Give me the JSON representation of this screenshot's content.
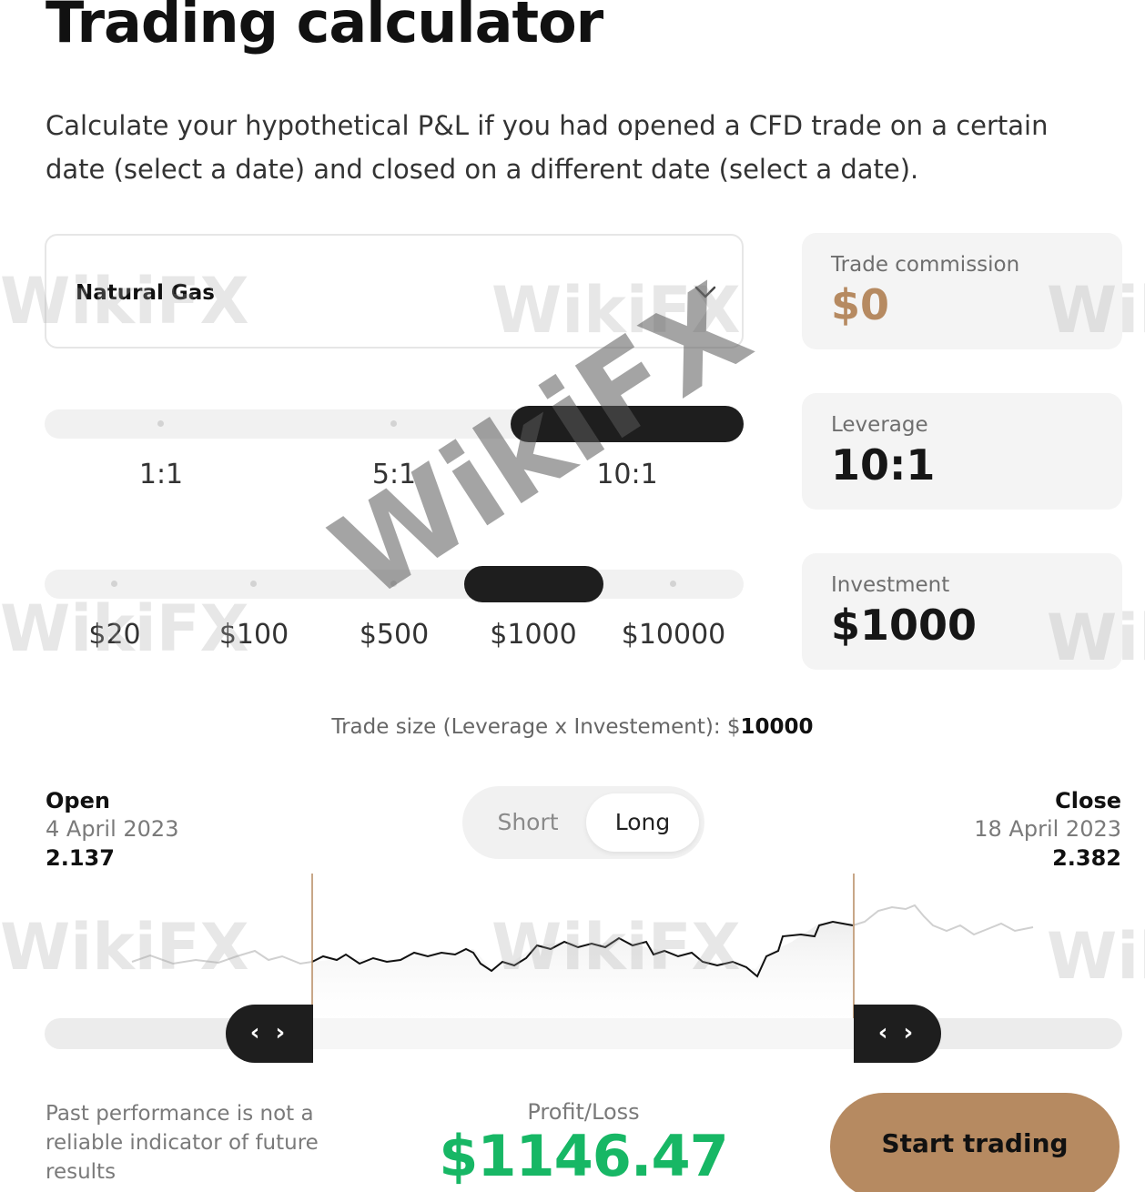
{
  "page": {
    "title": "Trading calculator",
    "subtitle": "Calculate your hypothetical P&L if you had opened a CFD trade on a certain date (select a date) and closed on a different date (select a date)."
  },
  "asset": {
    "selected": "Natural Gas",
    "icon": "chevron-down-icon"
  },
  "leverage_slider": {
    "options": [
      "1:1",
      "5:1",
      "10:1"
    ],
    "selected": "10:1"
  },
  "investment_slider": {
    "options": [
      "$20",
      "$100",
      "$500",
      "$1000",
      "$10000"
    ],
    "selected": "$1000"
  },
  "cards": {
    "commission": {
      "label": "Trade commission",
      "value": "$0"
    },
    "leverage": {
      "label": "Leverage",
      "value": "10:1"
    },
    "investment": {
      "label": "Investment",
      "value": "$1000"
    }
  },
  "trade_size": {
    "label": "Trade size (Leverage x Investement): $",
    "value": "10000"
  },
  "open": {
    "label": "Open",
    "date": "4 April 2023",
    "price": "2.137"
  },
  "close": {
    "label": "Close",
    "date": "18 April 2023",
    "price": "2.382"
  },
  "direction": {
    "short": "Short",
    "long": "Long",
    "selected": "Long"
  },
  "range_handles": {
    "left_glyph": "‹ ›",
    "right_glyph": "‹ ›"
  },
  "disclaimer": "Past performance is not a reliable indicator of future results",
  "profit_loss": {
    "label": "Profit/Loss",
    "value": "$1146.47"
  },
  "cta": {
    "label": "Start trading"
  },
  "watermark": "WikiFX",
  "colors": {
    "accent": "#b68a61",
    "profit": "#17b765",
    "dark": "#1e1e1e"
  }
}
